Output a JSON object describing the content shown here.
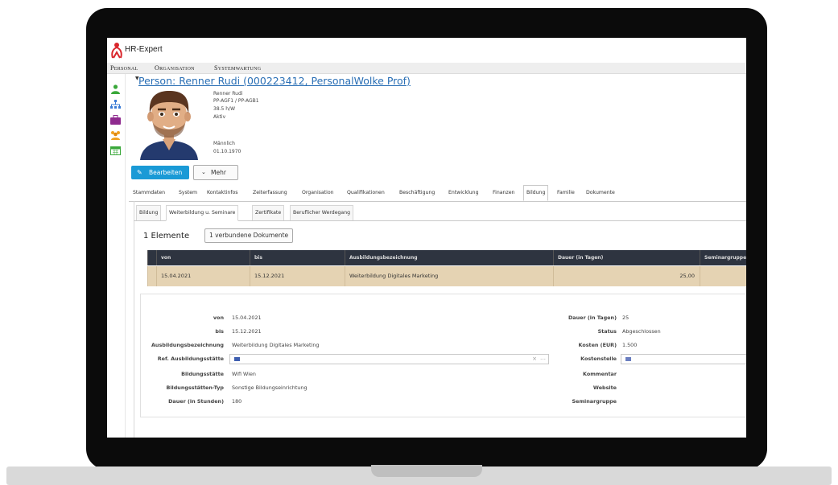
{
  "app": {
    "title": "HR-Expert"
  },
  "menu": [
    "Personal",
    "Organisation",
    "Systemwartung"
  ],
  "rail_icons": [
    "person-icon",
    "org-chart-icon",
    "briefcase-icon",
    "group-icon",
    "calendar-icon"
  ],
  "person": {
    "title": "Person: Renner Rudi (000223412, PersonalWolke Prof)",
    "name": "Renner Rudi",
    "groups": "PP-AGF1 / PP-AGB1",
    "hours": "38.5 h/W",
    "status": "Aktiv",
    "gender": "Männlich",
    "birthdate": "01.10.1970"
  },
  "actions": {
    "edit": "Bearbeiten",
    "more": "Mehr"
  },
  "tabs": [
    "Stammdaten",
    "System",
    "Kontaktinfos",
    "Zeiterfassung",
    "Organisation",
    "Qualifikationen",
    "Beschäftigung",
    "Entwicklung",
    "Finanzen",
    "Bildung",
    "Familie",
    "Dokumente"
  ],
  "active_tab": "Bildung",
  "subtabs": [
    "Bildung",
    "Weiterbildung u. Seminare",
    "Zertifikate",
    "Beruflicher Werdegang"
  ],
  "active_subtab": "Weiterbildung u. Seminare",
  "list": {
    "count_label": "1 Elemente",
    "docs_button": "1 verbundene Dokumente",
    "columns": [
      "von",
      "bis",
      "Ausbildungsbezeichnung",
      "Dauer (in Tagen)",
      "Seminargruppe"
    ],
    "rows": [
      [
        "15.04.2021",
        "15.12.2021",
        "Weiterbildung Digitales Marketing",
        "25,00",
        ""
      ]
    ]
  },
  "detail": {
    "left": [
      {
        "label": "von",
        "value": "15.04.2021"
      },
      {
        "label": "bis",
        "value": "15.12.2021"
      },
      {
        "label": "Ausbildungsbezeichnung",
        "value": "Weiterbildung Digitales Marketing"
      },
      {
        "label": "Ref. Ausbildungsstätte",
        "value": ""
      },
      {
        "label": "Bildungsstätte",
        "value": "Wifi Wien"
      },
      {
        "label": "Bildungsstätten-Typ",
        "value": "Sonstige Bildungseinrichtung"
      },
      {
        "label": "Dauer (in Stunden)",
        "value": "180"
      }
    ],
    "right": [
      {
        "label": "Dauer (in Tagen)",
        "value": "25"
      },
      {
        "label": "Status",
        "value": "Abgeschlossen"
      },
      {
        "label": "Kosten (EUR)",
        "value": "1.500"
      },
      {
        "label": "Kostenstelle",
        "value": ""
      },
      {
        "label": "Kommentar",
        "value": ""
      },
      {
        "label": "Website",
        "value": ""
      },
      {
        "label": "Seminargruppe",
        "value": ""
      }
    ]
  },
  "colors": {
    "accent": "#1a9ad6",
    "link": "#2a6fb5",
    "table_header": "#2e3440",
    "row_highlight": "#e5d3b3"
  }
}
